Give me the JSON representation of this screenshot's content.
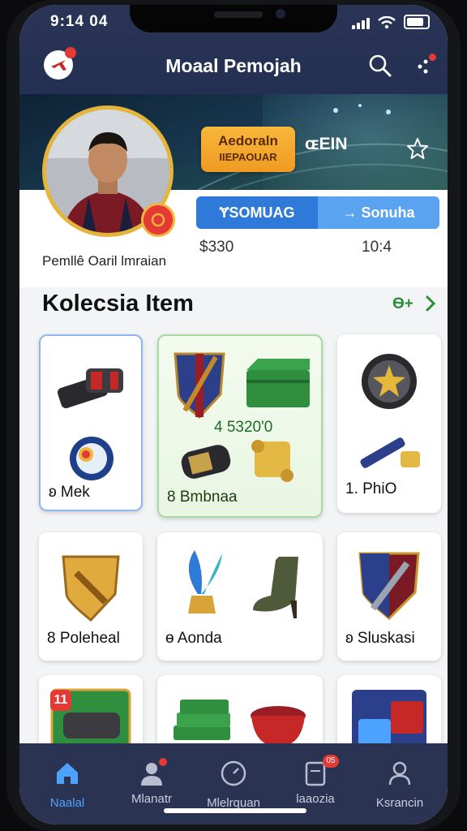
{
  "status_bar": {
    "time": "9:14 04"
  },
  "header": {
    "title": "Moaal Pemojah"
  },
  "profile": {
    "name": "Pemllê Oaril lmraian",
    "level_badge": {
      "line1": "Aedoraln",
      "line2": "IIEPAOUAR"
    },
    "coin_label": "ɶEIN",
    "tabs": [
      {
        "label": "ɎSOMUAG",
        "active": true
      },
      {
        "label": "→ Sonuha",
        "active": false
      }
    ],
    "stats": [
      "$330",
      "10:4"
    ]
  },
  "collection": {
    "title": "Kolecsia Item",
    "more_label": "Ѳ+",
    "cards": [
      {
        "label": "ʚ Mek",
        "icons": [
          "gauntlet-icon",
          "ring-icon"
        ]
      },
      {
        "price": "4 5320'0",
        "label": "8 Bmbnaa",
        "icons": [
          "shield-sword-icon",
          "chest-icon",
          "bracer-icon",
          "scroll-icon"
        ]
      },
      {
        "label": "1. PhiO",
        "icons": [
          "star-medal-icon",
          "spyglass-icon"
        ]
      },
      {
        "label": "8 Poleheal",
        "icons": [
          "gold-shield-icon"
        ]
      },
      {
        "label": "ɵ Aonda",
        "icons": [
          "feather-bell-icon",
          "boot-icon"
        ]
      },
      {
        "label": "ʚ Sluskasi",
        "icons": [
          "crest-shield-icon"
        ]
      },
      {
        "badge": "11",
        "icons": [
          "weapon-card-icon"
        ]
      },
      {
        "icons": [
          "cash-stack-icon",
          "cauldron-icon"
        ]
      },
      {
        "icons": [
          "dice-box-icon"
        ]
      }
    ]
  },
  "bottom_nav": {
    "items": [
      {
        "label": "Naalal",
        "icon": "home-icon",
        "active": true
      },
      {
        "label": "Mlanatr",
        "icon": "user-icon",
        "dot": true
      },
      {
        "label": "Mlelrquan",
        "icon": "gauge-icon"
      },
      {
        "label": "laaozia",
        "icon": "tablet-icon",
        "count": "05"
      },
      {
        "label": "Ksrancin",
        "icon": "profile-icon"
      }
    ]
  },
  "colors": {
    "accent": "#2f7ad8",
    "header_bg": "#2a3457",
    "gold": "#f2b43a",
    "alert": "#e53935",
    "link_green": "#2e8b3a"
  }
}
